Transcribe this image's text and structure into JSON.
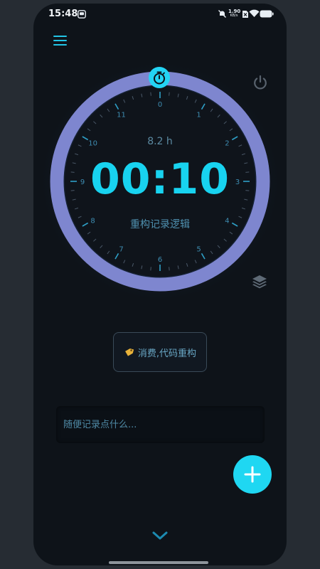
{
  "status_bar": {
    "time": "15:48",
    "net_speed_value": "1.90",
    "net_speed_unit": "KB/s"
  },
  "timer": {
    "hours_total": "8.2 h",
    "elapsed": "00:10",
    "task_title": "重构记录逻辑",
    "dial_numbers": [
      "0",
      "1",
      "2",
      "3",
      "4",
      "5",
      "6",
      "7",
      "8",
      "9",
      "10",
      "11"
    ],
    "ring_color": "#7e86cf",
    "accent_color": "#1fd3f0"
  },
  "category": {
    "icon": "tag-icon",
    "label": "消费,代码重构"
  },
  "note": {
    "placeholder": "随便记录点什么..."
  },
  "colors": {
    "background": "#0e1319",
    "fab": "#1fd7f2"
  }
}
